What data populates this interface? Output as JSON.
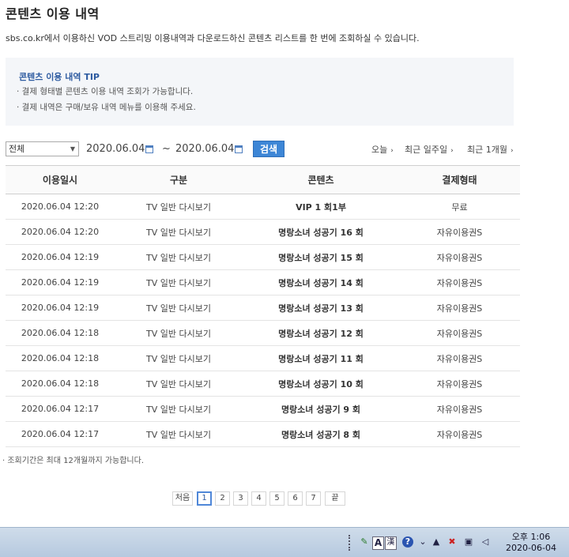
{
  "header": {
    "title": "콘텐츠 이용 내역",
    "description": "sbs.co.kr에서 이용하신 VOD 스트리밍 이용내역과 다운로드하신 콘텐츠 리스트를 한 번에 조회하실 수 있습니다."
  },
  "tip": {
    "title": "콘텐츠 이용 내역 TIP",
    "lines": [
      "· 결제 형태별 콘텐츠 이용 내역 조회가 가능합니다.",
      "· 결제 내역은 구매/보유 내역 메뉴를 이용해 주세요."
    ]
  },
  "filter": {
    "select_value": "전체",
    "start_date": "2020.06.04",
    "end_date": "2020.06.04",
    "separator": "~",
    "search_label": "검색",
    "quick": [
      "오늘",
      "최근 일주일",
      "최근 1개월"
    ]
  },
  "table": {
    "headers": [
      "이용일시",
      "구분",
      "콘텐츠",
      "결제형태"
    ],
    "rows": [
      [
        "2020.06.04 12:20",
        "TV 일반 다시보기",
        "VIP 1 회1부",
        "무료"
      ],
      [
        "2020.06.04 12:20",
        "TV 일반 다시보기",
        "명랑소녀 성공기 16 회",
        "자유이용권S"
      ],
      [
        "2020.06.04 12:19",
        "TV 일반 다시보기",
        "명랑소녀 성공기 15 회",
        "자유이용권S"
      ],
      [
        "2020.06.04 12:19",
        "TV 일반 다시보기",
        "명랑소녀 성공기 14 회",
        "자유이용권S"
      ],
      [
        "2020.06.04 12:19",
        "TV 일반 다시보기",
        "명랑소녀 성공기 13 회",
        "자유이용권S"
      ],
      [
        "2020.06.04 12:18",
        "TV 일반 다시보기",
        "명랑소녀 성공기 12 회",
        "자유이용권S"
      ],
      [
        "2020.06.04 12:18",
        "TV 일반 다시보기",
        "명랑소녀 성공기 11 회",
        "자유이용권S"
      ],
      [
        "2020.06.04 12:18",
        "TV 일반 다시보기",
        "명랑소녀 성공기 10 회",
        "자유이용권S"
      ],
      [
        "2020.06.04 12:17",
        "TV 일반 다시보기",
        "명랑소녀 성공기 9 회",
        "자유이용권S"
      ],
      [
        "2020.06.04 12:17",
        "TV 일반 다시보기",
        "명랑소녀 성공기 8 회",
        "자유이용권S"
      ]
    ]
  },
  "note": "· 조회기간은 최대 12개월까지 가능합니다.",
  "pagination": {
    "first": "처음",
    "pages": [
      "1",
      "2",
      "3",
      "4",
      "5",
      "6",
      "7"
    ],
    "current": "1",
    "last": "끝"
  },
  "taskbar": {
    "ime_mode": "A",
    "ime_hanja": "漢",
    "time": "오후 1:06",
    "date": "2020-06-04"
  },
  "colors": {
    "accent": "#3d86d6",
    "tip_title": "#2c5aa0",
    "tip_bg": "#f4f6f9"
  }
}
